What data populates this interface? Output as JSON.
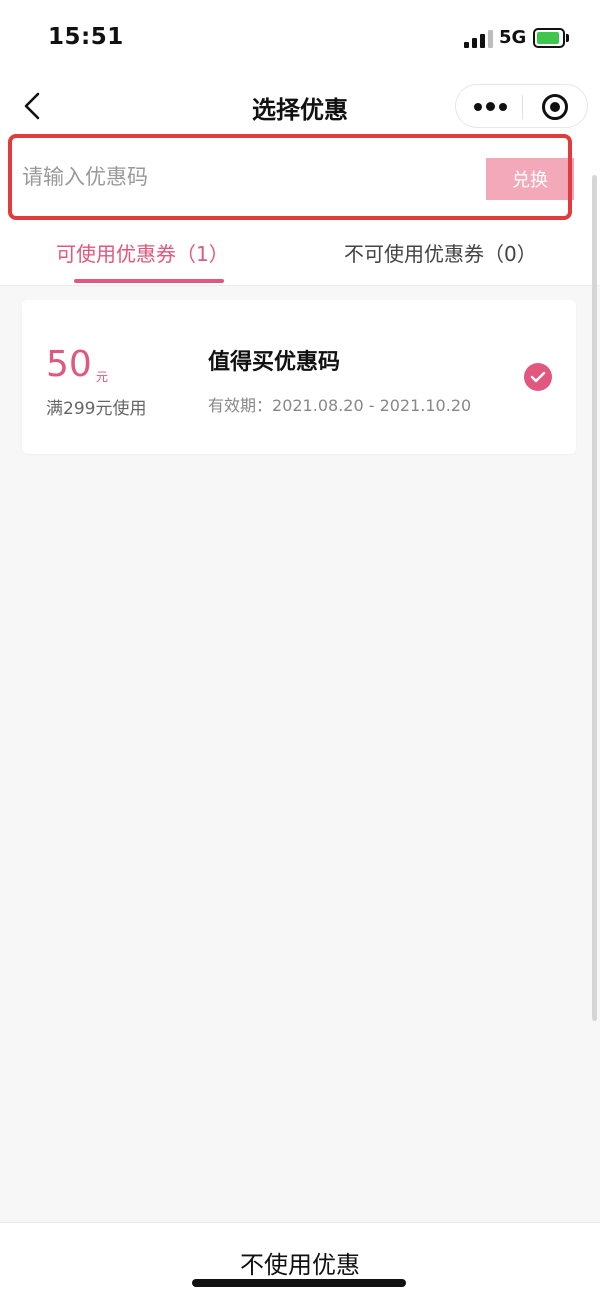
{
  "status_bar": {
    "time": "15:51",
    "network": "5G",
    "battery_level_percent": 90,
    "icons": [
      "signal-icon",
      "battery-charging-icon"
    ]
  },
  "nav": {
    "title": "选择优惠",
    "icons": [
      "back-icon",
      "more-icon",
      "target-icon"
    ]
  },
  "redeem": {
    "placeholder": "请输入优惠码",
    "value": "",
    "button_label": "兑换",
    "button_color": "#f4a9ba",
    "highlight_color": "#e03c3c"
  },
  "tabs": [
    {
      "label": "可使用优惠券（1）",
      "active": true
    },
    {
      "label": "不可使用优惠券（0）",
      "active": false
    }
  ],
  "accent_color": "#e2577e",
  "coupons": [
    {
      "amount": "50",
      "unit": "元",
      "threshold": "满299元使用",
      "name": "值得买优惠码",
      "validity_label": "有效期：",
      "validity_range": "2021.08.20 - 2021.10.20",
      "selected": true
    }
  ],
  "bottom": {
    "no_coupon_label": "不使用优惠"
  }
}
